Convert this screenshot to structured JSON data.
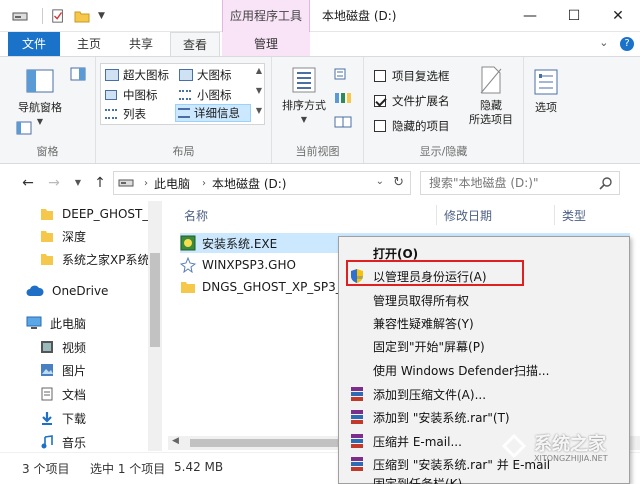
{
  "titlebar": {
    "contextual_tab": "应用程序工具",
    "title": "本地磁盘 (D:)",
    "minimize": "—",
    "maximize": "☐",
    "close": "✕"
  },
  "tabs": {
    "file": "文件",
    "home": "主页",
    "share": "共享",
    "view": "查看",
    "manage": "管理"
  },
  "ribbon": {
    "panes": {
      "label": "窗格",
      "navigation_pane": "导航窗格"
    },
    "layout": {
      "label": "布局",
      "extra_large_icons": "超大图标",
      "large_icons": "大图标",
      "medium_icons": "中图标",
      "small_icons": "小图标",
      "list": "列表",
      "details": "详细信息"
    },
    "current_view": {
      "label": "当前视图",
      "sort_by": "排序方式"
    },
    "show_hide": {
      "label": "显示/隐藏",
      "item_checkboxes": "项目复选框",
      "item_checkboxes_checked": false,
      "file_extensions": "文件扩展名",
      "file_extensions_checked": true,
      "hidden_items": "隐藏的项目",
      "hidden_items_checked": false,
      "hide_selected_line1": "隐藏",
      "hide_selected_line2": "所选项目"
    },
    "options": "选项"
  },
  "address": {
    "crumbs": [
      "此电脑",
      "本地磁盘 (D:)"
    ],
    "search_placeholder": "搜索\"本地磁盘 (D:)\""
  },
  "nav_items": [
    {
      "label": "DEEP_GHOST_V",
      "icon": "folder-icon"
    },
    {
      "label": "深度",
      "icon": "folder-icon"
    },
    {
      "label": "系统之家XP系统",
      "icon": "folder-icon"
    },
    {
      "label": "OneDrive",
      "icon": "cloud-icon"
    },
    {
      "label": "此电脑",
      "icon": "computer-icon"
    },
    {
      "label": "视频",
      "icon": "video-icon"
    },
    {
      "label": "图片",
      "icon": "picture-icon"
    },
    {
      "label": "文档",
      "icon": "document-icon"
    },
    {
      "label": "下载",
      "icon": "download-icon"
    },
    {
      "label": "音乐",
      "icon": "music-icon"
    }
  ],
  "columns": {
    "name": "名称",
    "date_modified": "修改日期",
    "type": "类型"
  },
  "files": [
    {
      "name": "安装系统.EXE",
      "selected": true
    },
    {
      "name": "WINXPSP3.GHO",
      "selected": false
    },
    {
      "name": "DNGS_GHOST_XP_SP3_",
      "selected": false
    }
  ],
  "status": {
    "item_count": "3 个项目",
    "selection": "选中 1 个项目",
    "size": "5.42 MB"
  },
  "context_menu": {
    "open": "打开(O)",
    "run_as_admin": "以管理员身份运行(A)",
    "take_ownership": "管理员取得所有权",
    "troubleshoot": "兼容性疑难解答(Y)",
    "pin_start": "固定到\"开始\"屏幕(P)",
    "defender": "使用 Windows Defender扫描...",
    "add_archive": "添加到压缩文件(A)...",
    "add_rar": "添加到 \"安装系统.rar\"(T)",
    "compress_email": "压缩并 E-mail...",
    "compress_rar_email": "压缩到 \"安装系统.rar\" 并 E-mail",
    "pin_taskbar": "固定到任务栏(K)"
  },
  "watermark": {
    "brand": "系统之家",
    "url": "XITONGZHIJIA.NET"
  },
  "colors": {
    "accent": "#1a73c9",
    "contextual": "#f8e3f7",
    "selection": "#cce8ff",
    "highlight_border": "#e02020"
  }
}
